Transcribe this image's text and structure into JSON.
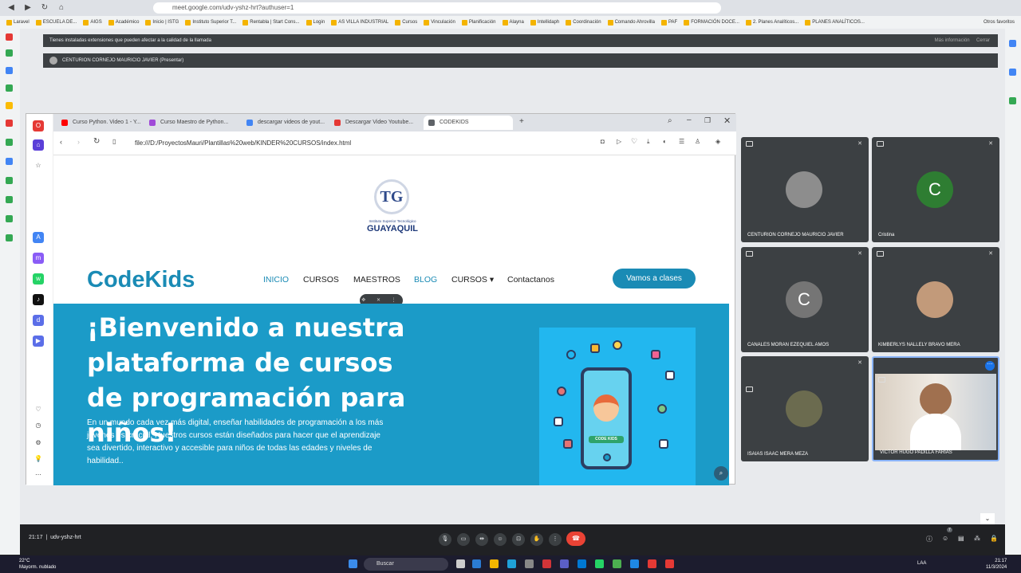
{
  "outer": {
    "url": "meet.google.com/udv-yshz-hrt?authuser=1",
    "bookmarks": [
      "Laravel",
      "ESCUELA DE...",
      "AIGS",
      "Académico",
      "Inicio | ISTG",
      "Instituto Superior T...",
      "Rentabla | Start Cons...",
      "Login",
      "AS VILLA INDUSTRIAL",
      "Cursos",
      "Vinculación",
      "Planificación",
      "Alayna",
      "Intellidaph",
      "Coordinación",
      "Comando Ahrovilla",
      "PAF",
      "FORMACIÓN DOCE...",
      "2. Planes Analíticos...",
      "PLANES ANALÍTICOS..."
    ],
    "all_bookmarks": "Otros favoritos"
  },
  "meet": {
    "notice": "Tienes instaladas extensiones que pueden afectar a la calidad de la llamada",
    "notice_more": "Más información",
    "notice_close": "Cerrar",
    "presenter": "CENTURION CORNEJO MAURICIO JAVIER (Presentar)",
    "time": "21:17",
    "code": "udv-yshz-hrt",
    "participants_badge": "7"
  },
  "inner": {
    "tabs": [
      {
        "label": "Curso Python. Video 1 - Y...",
        "color": "#ff0000"
      },
      {
        "label": "Curso Maestro de Python...",
        "color": "#a04bd8"
      },
      {
        "label": "descargar videos de yout...",
        "color": "#4285f4"
      },
      {
        "label": "Descargar Video Youtube...",
        "color": "#e53935"
      },
      {
        "label": "CODEKIDS",
        "color": "#5f6368"
      }
    ],
    "url": "file:///D:/ProyectosMauri/Plantillas%20web/KINDER%20CURSOS/index.html"
  },
  "page": {
    "logo_small": "Instituto Superior Tecnológico",
    "logo_name": "GUAYAQUIL",
    "logo_mark": "TG",
    "brand": "CodeKids",
    "nav": [
      "INICIO",
      "CURSOS",
      "MAESTROS",
      "BLOG",
      "CURSOS ▾",
      "Contactanos"
    ],
    "cta": "Vamos a clases",
    "hero_title": "¡Bienvenido a nuestra plataforma de cursos de programación para niños!",
    "hero_text": "En un mundo cada vez más digital, enseñar habilidades de programación a los más jóvenes es crucial. Nuestros cursos están diseñados para hacer que el aprendizaje sea divertido, interactivo y accesible para niños de todas las edades y niveles de habilidad..",
    "phone_label": "CODE KIDS"
  },
  "tiles": [
    {
      "name": "CENTURION CORNEJO MAURICIO JAVIER",
      "initial": "",
      "color": "#8d8d8d"
    },
    {
      "name": "Cristina",
      "initial": "C",
      "color": "#2e7d32"
    },
    {
      "name": "CANALES MORAN EZEQUIEL AMOS",
      "initial": "C",
      "color": "#757575"
    },
    {
      "name": "KIMBERLYS NALLELY BRAVO MERA",
      "initial": "",
      "color": "#c29a7a"
    },
    {
      "name": "ISAIAS ISAAC MERA MEZA",
      "initial": "",
      "color": "#6b6b4f"
    },
    {
      "name": "VICTOR HUGO PADILLA FARIAS",
      "initial": "",
      "color": ""
    }
  ],
  "taskbar": {
    "weather_temp": "22°C",
    "weather_desc": "Mayorm. nublado",
    "search": "Buscar",
    "lang": "LAA",
    "time": "21:17",
    "date": "11/3/2024"
  }
}
